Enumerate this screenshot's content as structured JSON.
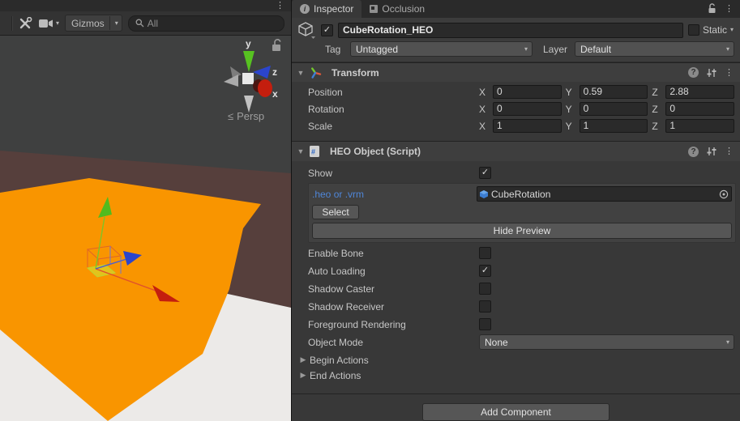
{
  "icons": {
    "menu": "⋮",
    "help": "?",
    "check": "✓",
    "dropdown": "▾",
    "foldout_open": "▼",
    "foldout_closed": "▶",
    "info": "i",
    "persp_glyph": "≤"
  },
  "scene": {
    "toolbar": {
      "gizmos_label": "Gizmos",
      "search_placeholder": "All"
    },
    "gizmo_widget": {
      "y_label": "y",
      "z_label": "z",
      "x_label": "x",
      "persp_label": "Persp"
    },
    "colors": {
      "background": "#3f4040",
      "wall": "#563f3c",
      "floor": "#eceae8",
      "cube": "#f99500",
      "axis_x": "#c41e0e",
      "axis_y": "#57c221",
      "axis_z": "#2b45cc"
    }
  },
  "inspector": {
    "tabs": [
      {
        "label": "Inspector"
      },
      {
        "label": "Occlusion"
      }
    ],
    "header": {
      "active": true,
      "name_value": "CubeRotation_HEO",
      "static_label": "Static",
      "static_checked": false,
      "tag_label": "Tag",
      "tag_value": "Untagged",
      "layer_label": "Layer",
      "layer_value": "Default"
    },
    "transform": {
      "title": "Transform",
      "axis_labels": [
        "X",
        "Y",
        "Z"
      ],
      "rows": [
        {
          "label": "Position",
          "x": "0",
          "y": "0.59",
          "z": "2.88"
        },
        {
          "label": "Rotation",
          "x": "0",
          "y": "0",
          "z": "0"
        },
        {
          "label": "Scale",
          "x": "1",
          "y": "1",
          "z": "1"
        }
      ]
    },
    "heo": {
      "title": "HEO Object (Script)",
      "show": {
        "label": "Show",
        "checked": true
      },
      "file_label": ".heo or .vrm",
      "file_value": "CubeRotation",
      "select_label": "Select",
      "hide_preview_label": "Hide Preview",
      "toggles": [
        {
          "label": "Enable Bone",
          "checked": false
        },
        {
          "label": "Auto Loading",
          "checked": true
        },
        {
          "label": "Shadow Caster",
          "checked": false
        },
        {
          "label": "Shadow Receiver",
          "checked": false
        },
        {
          "label": "Foreground Rendering",
          "checked": false
        }
      ],
      "object_mode_label": "Object Mode",
      "object_mode_value": "None",
      "foldouts": [
        {
          "label": "Begin Actions"
        },
        {
          "label": "End Actions"
        }
      ]
    },
    "add_component_label": "Add Component"
  }
}
